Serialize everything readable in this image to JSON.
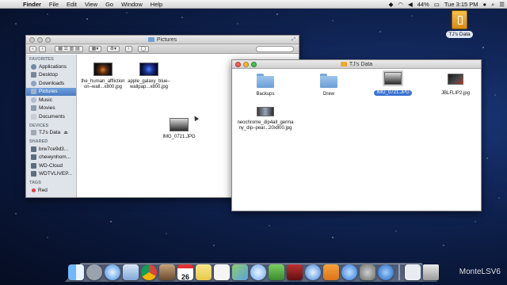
{
  "menubar": {
    "apple_glyph": "",
    "items": [
      "Finder",
      "File",
      "Edit",
      "View",
      "Go",
      "Window",
      "Help"
    ],
    "status": [
      "44%",
      "Tue 3:15 PM"
    ]
  },
  "desktop": {
    "drive_label": "TJ's Data",
    "watermark": "MonteLSV6"
  },
  "pictures_window": {
    "title": "Pictures",
    "sidebar": {
      "favorites_header": "FAVORITES",
      "favorites": [
        {
          "label": "Applications",
          "icon": "applications-icon"
        },
        {
          "label": "Desktop",
          "icon": "desktop-icon"
        },
        {
          "label": "Downloads",
          "icon": "downloads-icon"
        },
        {
          "label": "Pictures",
          "icon": "pictures-icon",
          "selected": true
        },
        {
          "label": "Music",
          "icon": "music-icon"
        },
        {
          "label": "Movies",
          "icon": "movies-icon"
        },
        {
          "label": "Documents",
          "icon": "documents-icon"
        }
      ],
      "devices_header": "DEVICES",
      "devices": [
        {
          "label": "TJ's Data",
          "icon": "drive-icon"
        }
      ],
      "shared_header": "SHARED",
      "shared": [
        {
          "label": "brw7ce9d3...",
          "icon": "network-icon"
        },
        {
          "label": "chewynhom...",
          "icon": "network-icon"
        },
        {
          "label": "WD-Cloud",
          "icon": "network-icon"
        },
        {
          "label": "WDTVLIVEP...",
          "icon": "network-icon"
        }
      ],
      "tags_header": "TAGS",
      "tags": [
        {
          "label": "Red",
          "color": "#e0443a"
        }
      ]
    },
    "files": [
      {
        "label": "the_human_affliction-wall...x800.jpg",
        "line1": "the_human_affliction",
        "line2": "on–wall...x800.jpg"
      },
      {
        "label": "apple_galaxy_blue-wallpap...x800.jpg",
        "line1": "apple_galaxy_blue–",
        "line2": "wallpap...x800.jpg"
      },
      {
        "label": "IMG_0721.JPG",
        "line1": "IMG_0721.JPG",
        "line2": ""
      }
    ]
  },
  "tjs_window": {
    "title": "TJ's Data",
    "files": [
      {
        "label": "Backups"
      },
      {
        "label": "Drew"
      },
      {
        "label": "IMG_0721.JPG",
        "selected": true
      },
      {
        "label": "JBLFLIP2.jpg"
      },
      {
        "line1": "neochrome_dip4all_germa",
        "line2": "ny_dip–pear...20x800.jpg"
      }
    ]
  },
  "colors": {
    "selection": "#3b73d1",
    "sidebar_bg": "#dfe4ea",
    "tag_red": "#e0443a"
  },
  "dock": {
    "icons": [
      "finder-icon",
      "launchpad-icon",
      "safari-icon",
      "mail-icon",
      "chrome-icon",
      "photos-icon",
      "calendar-icon",
      "notes-icon",
      "reminders-icon",
      "maps-icon",
      "messages-icon",
      "facetime-icon",
      "photo-booth-icon",
      "itunes-icon",
      "ibooks-icon",
      "app-store-icon",
      "system-preferences-icon",
      "quicktime-icon",
      "downloads-stack-icon",
      "trash-icon"
    ],
    "calendar_day": "26"
  }
}
